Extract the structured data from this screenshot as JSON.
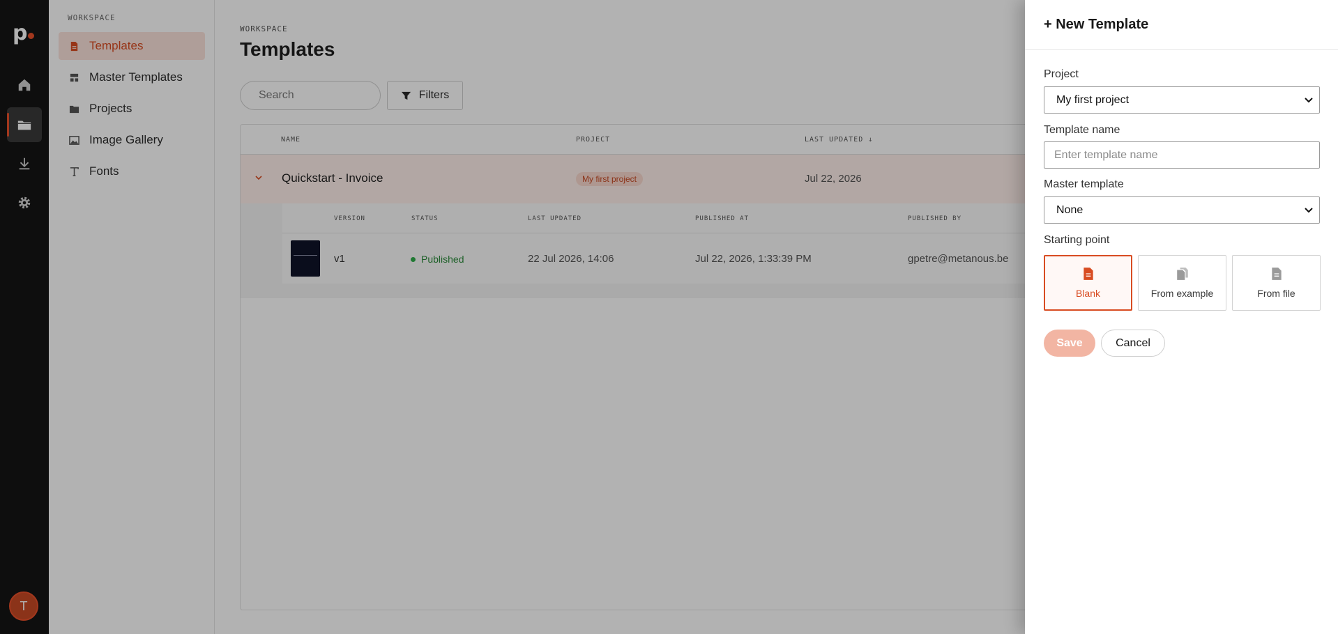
{
  "rail": {
    "logo": "p",
    "avatar_initial": "T",
    "items": [
      {
        "icon": "home-icon"
      },
      {
        "icon": "folder-icon"
      },
      {
        "icon": "download-icon"
      },
      {
        "icon": "gear-icon"
      }
    ]
  },
  "sidebar": {
    "heading": "WORKSPACE",
    "items": [
      {
        "label": "Templates",
        "icon": "file-icon"
      },
      {
        "label": "Master Templates",
        "icon": "layout-icon"
      },
      {
        "label": "Projects",
        "icon": "folder-icon"
      },
      {
        "label": "Image Gallery",
        "icon": "image-icon"
      },
      {
        "label": "Fonts",
        "icon": "type-icon"
      }
    ]
  },
  "main": {
    "breadcrumb": "WORKSPACE",
    "title": "Templates",
    "search_placeholder": "Search",
    "filters_label": "Filters",
    "table": {
      "columns": {
        "name": "NAME",
        "project": "PROJECT",
        "last_updated": "LAST UPDATED ↓"
      },
      "row": {
        "name": "Quickstart - Invoice",
        "project": "My first project",
        "last_updated": "Jul 22, 2026"
      },
      "versions": {
        "columns": {
          "version": "VERSION",
          "status": "STATUS",
          "last_updated": "LAST UPDATED",
          "published_at": "PUBLISHED AT",
          "published_by": "PUBLISHED BY"
        },
        "row": {
          "version": "v1",
          "status": "Published",
          "last_updated": "22 Jul 2026, 14:06",
          "published_at": "Jul 22, 2026, 1:33:39 PM",
          "published_by": "gpetre@metanous.be"
        }
      }
    }
  },
  "drawer": {
    "title": "+ New Template",
    "project_label": "Project",
    "project_value": "My first project",
    "name_label": "Template name",
    "name_placeholder": "Enter template name",
    "master_label": "Master template",
    "master_value": "None",
    "starting_label": "Starting point",
    "options": [
      {
        "label": "Blank",
        "selected": true
      },
      {
        "label": "From example",
        "selected": false
      },
      {
        "label": "From file",
        "selected": false
      }
    ],
    "save_label": "Save",
    "cancel_label": "Cancel"
  },
  "colors": {
    "accent": "#d84c22",
    "rail_bg": "#151515",
    "published": "#2a8a3a"
  }
}
